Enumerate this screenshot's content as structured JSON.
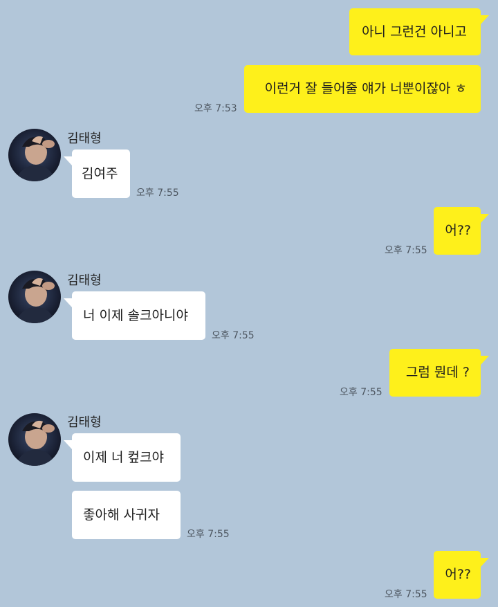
{
  "chat": {
    "background_color": "#b2c6d9",
    "sent_bubble_color": "#fef01b",
    "received_bubble_color": "#ffffff",
    "contact_name": "김태형",
    "messages": [
      {
        "direction": "sent",
        "text": "아니 그런건 아니고",
        "time": ""
      },
      {
        "direction": "sent",
        "text": "이런거 잘 들어줄 얘가 너뿐이잖아 ㅎ",
        "time": "오후 7:53"
      },
      {
        "direction": "received",
        "sender": "김태형",
        "text": "김여주",
        "time": "오후 7:55"
      },
      {
        "direction": "sent",
        "text": "어??",
        "time": "오후 7:55"
      },
      {
        "direction": "received",
        "sender": "김태형",
        "text": "너 이제 솔크아니야",
        "time": "오후 7:55"
      },
      {
        "direction": "sent",
        "text": "그럼 뭔데 ?",
        "time": "오후 7:55"
      },
      {
        "direction": "received",
        "sender": "김태형",
        "text": "이제 너 컾크야",
        "time": ""
      },
      {
        "direction": "received",
        "sender": "김태형",
        "text": "좋아해 사귀자",
        "time": "오후 7:55"
      },
      {
        "direction": "sent",
        "text": "어??",
        "time": "오후 7:55"
      }
    ]
  }
}
